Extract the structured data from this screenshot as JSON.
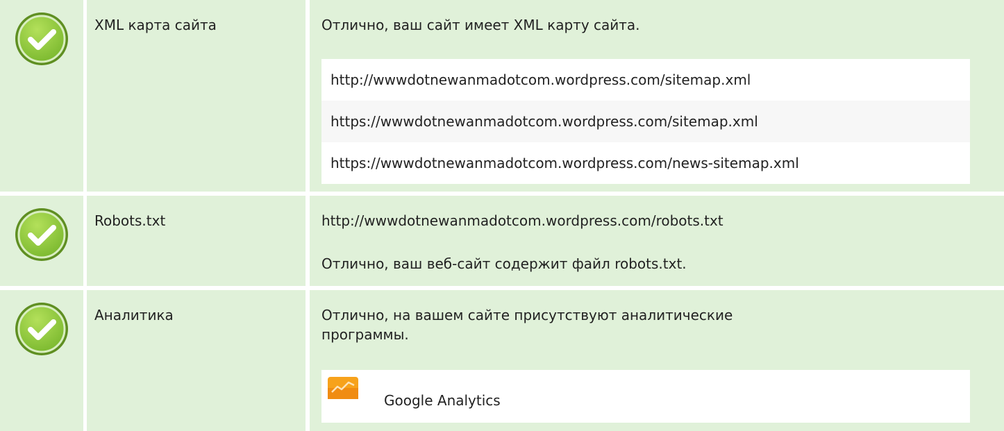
{
  "rows": [
    {
      "label": "XML карта сайта",
      "status": "Отлично, ваш сайт имеет XML карту сайта.",
      "sitemaps": [
        "http://wwwdotnewanmadotcom.wordpress.com/sitemap.xml",
        "https://wwwdotnewanmadotcom.wordpress.com/sitemap.xml",
        "https://wwwdotnewanmadotcom.wordpress.com/news-sitemap.xml"
      ]
    },
    {
      "label": "Robots.txt",
      "url": "http://wwwdotnewanmadotcom.wordpress.com/robots.txt",
      "status": "Отлично, ваш веб-сайт содержит файл robots.txt."
    },
    {
      "label": "Аналитика",
      "status": "Отлично, на вашем сайте присутствуют аналитические программы.",
      "tools": [
        {
          "name": "Google Analytics",
          "icon": "google-analytics-icon"
        }
      ]
    }
  ],
  "icons": {
    "check": "check-circle-icon"
  },
  "colors": {
    "row_bg": "#e0f1d9",
    "check_green": "#8cc63f",
    "check_dark": "#6a9a2a",
    "analytics_orange": "#f7a21b"
  }
}
